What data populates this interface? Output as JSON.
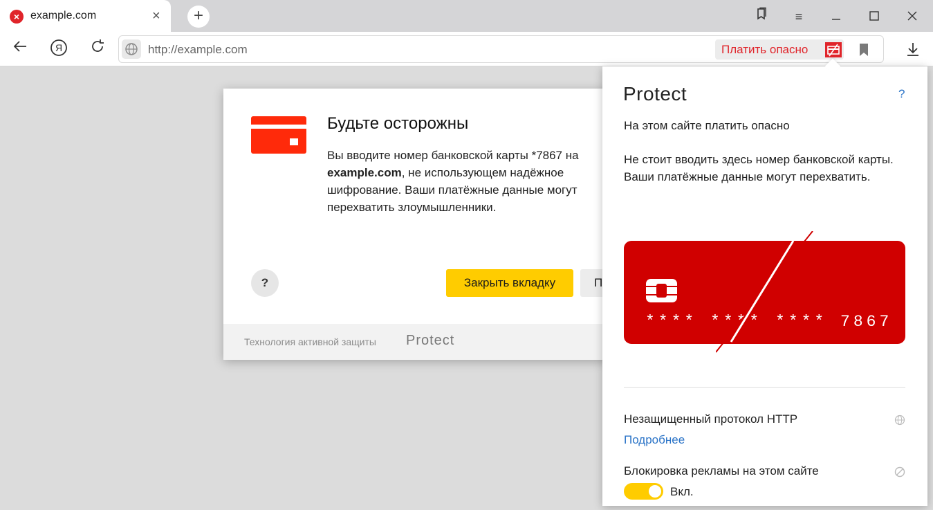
{
  "tab": {
    "title": "example.com",
    "favicon": "error-x-icon",
    "close": "×"
  },
  "newtab": {
    "label": "+"
  },
  "toolbar": {
    "url": "http://example.com",
    "pay_warning": "Платить опасно"
  },
  "modal": {
    "title": "Будьте осторожны",
    "text_pre": "Вы вводите номер банковской карты *7867 на",
    "domain": "example.com",
    "text_post": ", не использующем надёжное шифрование. Ваши платёжные данные могут перехватить злоумышленники.",
    "help": "?",
    "close_button": "Закрыть вкладку",
    "other_button": "П",
    "footer_text": "Технология активной защиты",
    "footer_brand": "Protect"
  },
  "popup": {
    "brand": "Protect",
    "help": "?",
    "heading": "На этом сайте платить опасно",
    "text": "Не стоит вводить здесь номер банковской карты. Ваши платёжные данные могут перехватить.",
    "card_number": "**** **** **** 7867",
    "http_label": "Незащищенный протокол HTTP",
    "more_link": "Подробнее",
    "ads_label": "Блокировка рекламы на этом сайте",
    "ads_toggle_label": "Вкл."
  },
  "colors": {
    "danger": "#e0242a",
    "card": "#d00000",
    "accent_yellow": "#ffcc00",
    "link": "#2a73c7"
  }
}
